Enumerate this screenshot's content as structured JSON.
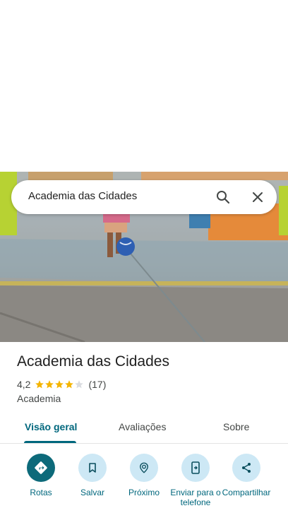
{
  "search": {
    "query": "Academia das Cidades"
  },
  "place": {
    "name": "Academia das Cidades",
    "rating": "4,2",
    "stars": 4,
    "reviews": "(17)",
    "category": "Academia"
  },
  "tabs": [
    {
      "label": "Visão geral",
      "active": true
    },
    {
      "label": "Avaliações",
      "active": false
    },
    {
      "label": "Sobre",
      "active": false
    }
  ],
  "actions": [
    {
      "label": "Rotas",
      "icon": "directions-icon"
    },
    {
      "label": "Salvar",
      "icon": "bookmark-icon"
    },
    {
      "label": "Próximo",
      "icon": "nearby-icon"
    },
    {
      "label": "Enviar para o telefone",
      "icon": "send-to-phone-icon"
    },
    {
      "label": "Compartilhar",
      "icon": "share-icon"
    }
  ],
  "colors": {
    "accent": "#00677d",
    "primary_button": "#0d6a7a",
    "tonal_button": "#cde8f5",
    "star": "#f4b400"
  }
}
